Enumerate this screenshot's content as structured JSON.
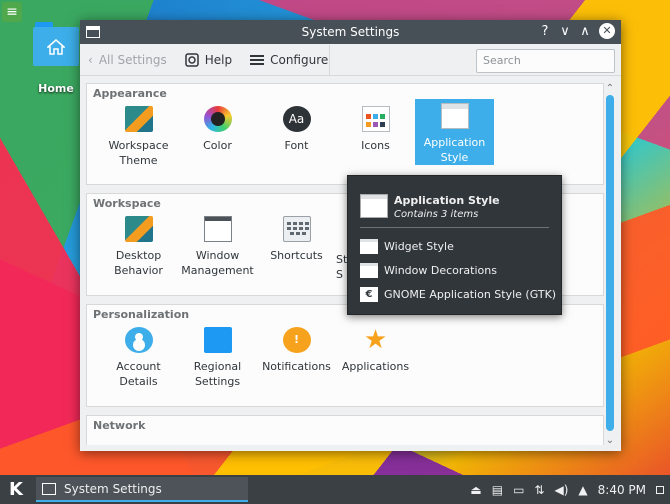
{
  "desktop": {
    "menu_icon": "hamburger-icon",
    "home_label": "Home"
  },
  "window": {
    "title": "System Settings",
    "controls": {
      "help": "?",
      "minimize": "∨",
      "maximize": "∧",
      "close": "✕"
    }
  },
  "toolbar": {
    "back_label": "All Settings",
    "help_label": "Help",
    "configure_label": "Configure",
    "search_placeholder": "Search"
  },
  "sections": [
    {
      "title": "Appearance",
      "items": [
        {
          "label": "Workspace Theme",
          "icon": "workspace-theme-icon"
        },
        {
          "label": "Color",
          "icon": "color-icon"
        },
        {
          "label": "Font",
          "icon": "font-icon",
          "glyph": "Aa"
        },
        {
          "label": "Icons",
          "icon": "icons-icon"
        },
        {
          "label": "Application Style",
          "icon": "application-style-icon",
          "selected": true
        }
      ]
    },
    {
      "title": "Workspace",
      "items": [
        {
          "label": "Desktop Behavior",
          "icon": "desktop-behavior-icon"
        },
        {
          "label": "Window Management",
          "icon": "window-management-icon"
        },
        {
          "label": "Shortcuts",
          "icon": "shortcuts-icon"
        },
        {
          "label": "St S",
          "icon": "startup-icon"
        }
      ]
    },
    {
      "title": "Personalization",
      "items": [
        {
          "label": "Account Details",
          "icon": "account-icon"
        },
        {
          "label": "Regional Settings",
          "icon": "regional-icon"
        },
        {
          "label": "Notifications",
          "icon": "notifications-icon",
          "glyph": "!"
        },
        {
          "label": "Applications",
          "icon": "applications-icon",
          "glyph": "★"
        }
      ]
    },
    {
      "title": "Network",
      "items": []
    }
  ],
  "tooltip": {
    "title": "Application Style",
    "subtitle": "Contains 3 items",
    "items": [
      {
        "label": "Widget Style",
        "icon": "widget-style-icon"
      },
      {
        "label": "Window Decorations",
        "icon": "window-decorations-icon"
      },
      {
        "label": "GNOME Application Style (GTK)",
        "icon": "gnome-icon",
        "glyph": "€"
      }
    ]
  },
  "taskbar": {
    "kmenu_glyph": "K",
    "task_label": "System Settings",
    "clock": "8:40 PM"
  },
  "colors": {
    "accent": "#3daee9",
    "titlebar": "#475057",
    "taskbar": "#3b4045"
  }
}
